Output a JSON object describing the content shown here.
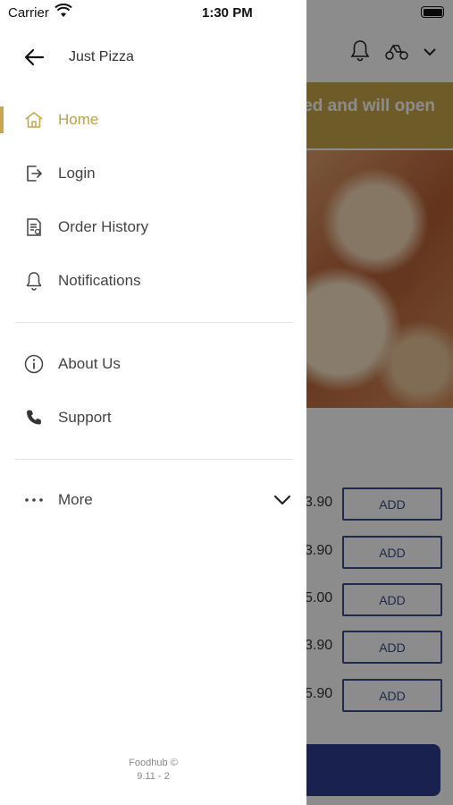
{
  "status_bar": {
    "carrier": "Carrier",
    "time": "1:30 PM"
  },
  "background": {
    "banner_text": "ed and will open",
    "prices": [
      "3.90",
      "3.90",
      "5.00",
      "3.90",
      "5.90"
    ],
    "add_label": "ADD"
  },
  "drawer": {
    "store_name": "Just Pizza",
    "primary_items": [
      {
        "label": "Home",
        "icon": "home-icon",
        "active": true
      },
      {
        "label": "Login",
        "icon": "login-icon"
      },
      {
        "label": "Order History",
        "icon": "order-history-icon"
      },
      {
        "label": "Notifications",
        "icon": "bell-icon"
      }
    ],
    "secondary_items": [
      {
        "label": "About Us",
        "icon": "info-icon"
      },
      {
        "label": "Support",
        "icon": "phone-icon"
      }
    ],
    "more": {
      "label": "More",
      "icon": "more-dots-icon"
    },
    "footer": {
      "brand": "Foodhub ©",
      "version": "9.11 - 2"
    }
  },
  "colors": {
    "accent": "#c9a84a",
    "active_text": "#b9a24a",
    "overlay": "rgba(0,0,0,0.45)",
    "cta": "#2f3f8f"
  }
}
